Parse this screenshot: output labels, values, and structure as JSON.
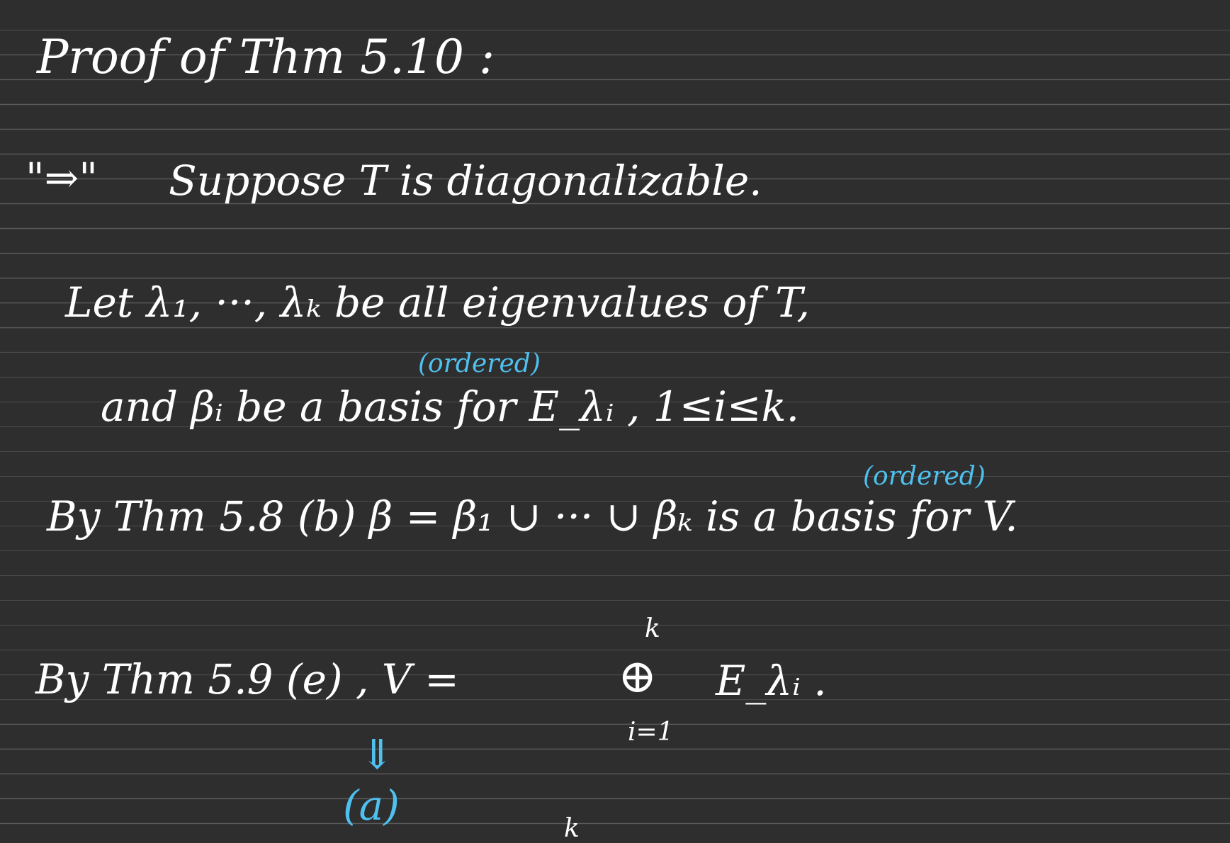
{
  "colors": {
    "background": "#2e2e2e",
    "ruling": "#5a5a5a",
    "ink": "#ffffff",
    "annotation": "#4fc1ee"
  },
  "title": "Proof of Thm 5.10 :",
  "forward_marker": "\"⇒\"",
  "line1": "Suppose   T  is  diagonalizable.",
  "line2": "Let λ₁, ···, λₖ  be  all  eigenvalues  of  T,",
  "line3": "and  βᵢ  be   a   basis  for  E_λᵢ ,  1≤i≤k.",
  "ordered_note_1": "(ordered)",
  "line4": "By  Thm 5.8 (b)   β = β₁ ∪ ··· ∪ βₖ   is  a  basis  for V.",
  "ordered_note_2": "(ordered)",
  "line5_left": "By Thm 5.9 (e) ,  V  =",
  "line5_sum": "⊕",
  "line5_sum_upper": "k",
  "line5_sum_lower": "i=1",
  "line5_right": "E_λᵢ .",
  "arrow_down": "⇓",
  "note_a": "(a)",
  "bottom_k": "k"
}
